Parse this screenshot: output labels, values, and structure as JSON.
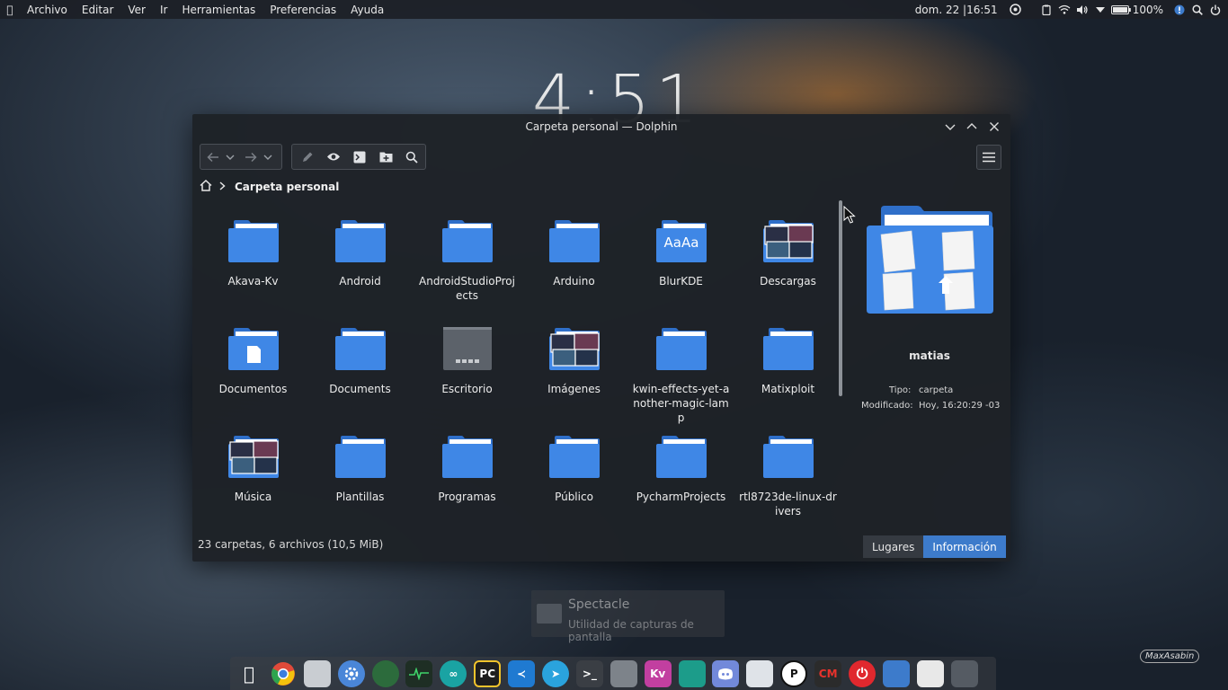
{
  "panel": {
    "menu": [
      "Archivo",
      "Editar",
      "Ver",
      "Ir",
      "Herramientas",
      "Preferencias",
      "Ayuda"
    ],
    "clock": "dom. 22 |16:51",
    "battery": "100%"
  },
  "desktop_clock": "4:51",
  "window": {
    "title": "Carpeta personal — Dolphin",
    "breadcrumb": "Carpeta personal",
    "items": [
      {
        "label": "Akava-Kv",
        "icon": "folder"
      },
      {
        "label": "Android",
        "icon": "folder"
      },
      {
        "label": "AndroidStudioProjects",
        "icon": "folder"
      },
      {
        "label": "Arduino",
        "icon": "folder"
      },
      {
        "label": "BlurKDE",
        "icon": "folder-fonts",
        "overlay": "AaAa"
      },
      {
        "label": "Descargas",
        "icon": "folder-preview"
      },
      {
        "label": "Documentos",
        "icon": "folder-document"
      },
      {
        "label": "Documents",
        "icon": "folder"
      },
      {
        "label": "Escritorio",
        "icon": "folder-desktop"
      },
      {
        "label": "Imágenes",
        "icon": "folder-preview"
      },
      {
        "label": "kwin-effects-yet-another-magic-lamp",
        "icon": "folder"
      },
      {
        "label": "Matixploit",
        "icon": "folder"
      },
      {
        "label": "Música",
        "icon": "folder-preview"
      },
      {
        "label": "Plantillas",
        "icon": "folder"
      },
      {
        "label": "Programas",
        "icon": "folder"
      },
      {
        "label": "Público",
        "icon": "folder"
      },
      {
        "label": "PycharmProjects",
        "icon": "folder"
      },
      {
        "label": "rtl8723de-linux-drivers",
        "icon": "folder"
      }
    ],
    "status": "23 carpetas, 6 archivos (10,5 MiB)",
    "tabs": {
      "places": "Lugares",
      "info": "Información"
    },
    "info": {
      "name": "matias",
      "type_label": "Tipo:",
      "type_value": "carpeta",
      "modified_label": "Modificado:",
      "modified_value": "Hoy, 16:20:29 -03"
    }
  },
  "spectacle": {
    "title": "Spectacle",
    "subtitle": "Utilidad de capturas de pantalla"
  },
  "dock": [
    {
      "name": "apple-icon",
      "color": "#3a3e44",
      "text": ""
    },
    {
      "name": "chrome-icon",
      "color": "#e04a3a",
      "text": ""
    },
    {
      "name": "files-icon",
      "color": "#c9cdd2",
      "text": ""
    },
    {
      "name": "settings-icon",
      "color": "#4a86d8",
      "text": ""
    },
    {
      "name": "globe-icon",
      "color": "#2c6b3c",
      "text": ""
    },
    {
      "name": "system-monitor-icon",
      "color": "#1e2e24",
      "text": ""
    },
    {
      "name": "arduino-icon",
      "color": "#1aa3a3",
      "text": "∞"
    },
    {
      "name": "pycharm-icon",
      "color": "#1e1e1e",
      "text": "PC"
    },
    {
      "name": "vscode-icon",
      "color": "#1f7ad1",
      "text": "≺"
    },
    {
      "name": "telegram-icon",
      "color": "#2aa3dd",
      "text": "➤"
    },
    {
      "name": "terminal-icon",
      "color": "#3a3e44",
      "text": ">_"
    },
    {
      "name": "screen-icon",
      "color": "#7d838a",
      "text": ""
    },
    {
      "name": "kv-icon",
      "color": "#c23fa0",
      "text": "Kv"
    },
    {
      "name": "device-icon",
      "color": "#1c9c8a",
      "text": ""
    },
    {
      "name": "discord-icon",
      "color": "#7289da",
      "text": ""
    },
    {
      "name": "installer-icon",
      "color": "#dfe3e8",
      "text": ""
    },
    {
      "name": "pb-icon",
      "color": "#ffffff",
      "text": "P"
    },
    {
      "name": "cm-icon",
      "color": "#2b2b2b",
      "text": "CM"
    },
    {
      "name": "power-icon",
      "color": "#e0282e",
      "text": "⏻"
    },
    {
      "name": "home-folder-icon",
      "color": "#3d7bcb",
      "text": ""
    },
    {
      "name": "trash-icon",
      "color": "#e8e8e8",
      "text": ""
    },
    {
      "name": "window-icon",
      "color": "#555b63",
      "text": ""
    }
  ],
  "watermark": "MaxAsabin",
  "colors": {
    "accent": "#3d7bcb",
    "folder": "#3f87e6"
  }
}
